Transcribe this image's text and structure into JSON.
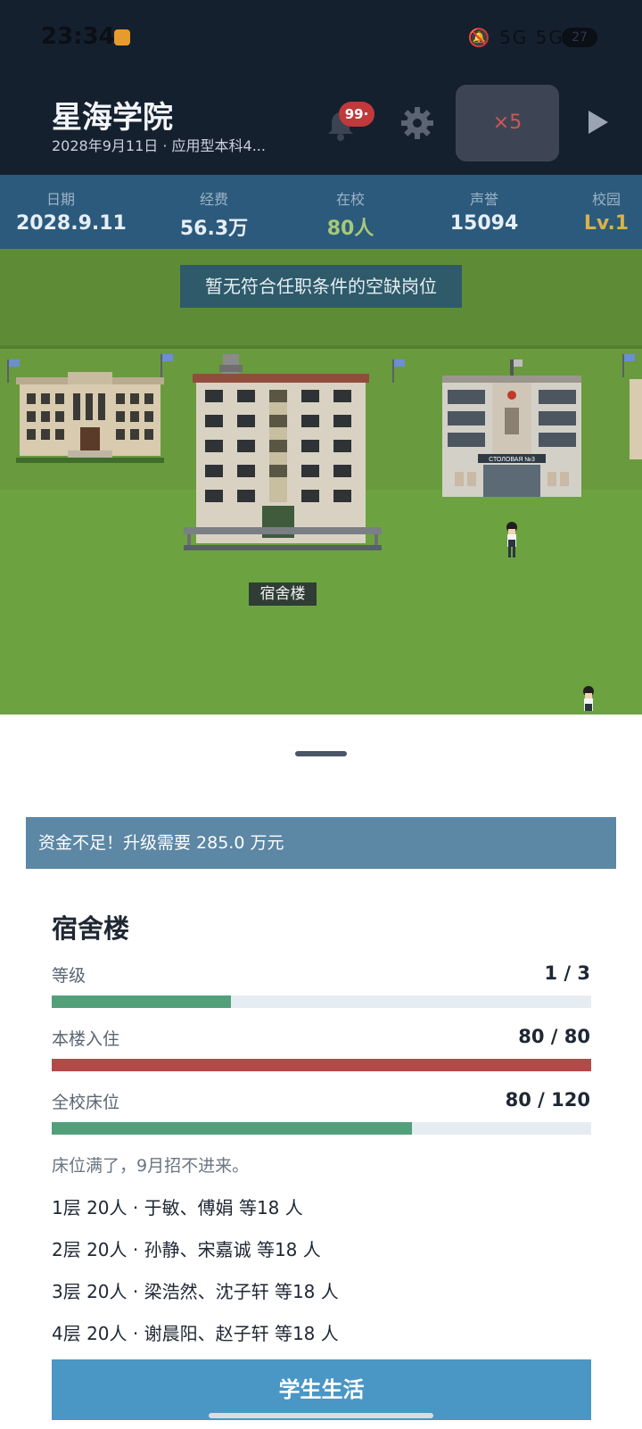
{
  "status_bar": {
    "time": "23:34",
    "app_icon": "game-app-icon",
    "system_icons": "🔕 5G 5G ≋",
    "battery": "27"
  },
  "header": {
    "school_name": "星海学院",
    "subtitle": "2028年9月11日 · 应用型本科4...",
    "notification_badge": "99·",
    "speed_label": "×5",
    "icons": [
      "bell-icon",
      "gear-icon",
      "play-icon"
    ]
  },
  "stats": [
    {
      "label": "日期",
      "value": "2028.9.11",
      "color": "#e7eef5"
    },
    {
      "label": "经费",
      "value": "56.3万",
      "color": "#e7eef5"
    },
    {
      "label": "在校",
      "value": "80人",
      "color": "#a5c97a"
    },
    {
      "label": "声誉",
      "value": "15094",
      "color": "#e7eef5"
    },
    {
      "label": "校园",
      "value": "Lv.1",
      "color": "#d8b24a"
    }
  ],
  "map": {
    "notice": "暂无符合任职条件的空缺岗位",
    "selected_building_label": "宿舍楼",
    "facade_sign": "СТОЛОВАЯ №3"
  },
  "sheet": {
    "alert": "资金不足！升级需要 285.0 万元",
    "building_name": "宿舍楼",
    "rows": [
      {
        "label": "等级",
        "value": "1 / 3",
        "fraction": 0.333,
        "color": "#52a07a"
      },
      {
        "label": "本楼入住",
        "value": "80 / 80",
        "fraction": 1.0,
        "color": "#b34a47"
      },
      {
        "label": "全校床位",
        "value": "80 / 120",
        "fraction": 0.667,
        "color": "#52a07a"
      }
    ],
    "hint": "床位满了，9月招不进来。",
    "floors": [
      "1层 20人 · 于敏、傅娟 等18 人",
      "2层 20人 · 孙静、宋嘉诚 等18 人",
      "3层 20人 · 梁浩然、沈子轩 等18 人",
      "4层 20人 · 谢晨阳、赵子轩 等18 人"
    ],
    "action_button": "学生生活"
  }
}
